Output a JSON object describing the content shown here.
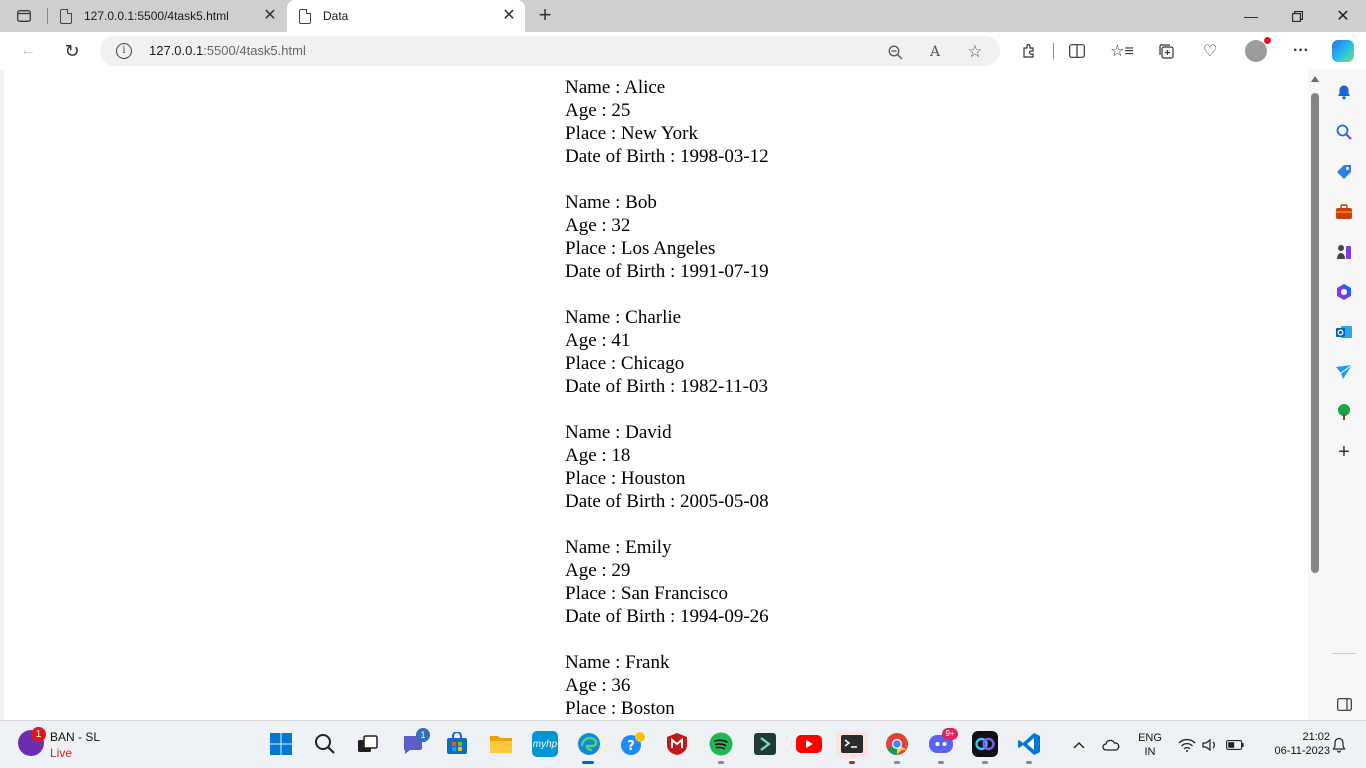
{
  "browser": {
    "tabs": [
      {
        "title": "127.0.0.1:5500/4task5.html",
        "active": false
      },
      {
        "title": "Data",
        "active": true
      }
    ],
    "address": {
      "host": "127.0.0.1",
      "rest": ":5500/4task5.html"
    }
  },
  "records": [
    {
      "name_label": "Name : Alice",
      "age_label": "Age : 25",
      "place_label": "Place : New York",
      "dob_label": "Date of Birth : 1998-03-12"
    },
    {
      "name_label": "Name : Bob",
      "age_label": "Age : 32",
      "place_label": "Place : Los Angeles",
      "dob_label": "Date of Birth : 1991-07-19"
    },
    {
      "name_label": "Name : Charlie",
      "age_label": "Age : 41",
      "place_label": "Place : Chicago",
      "dob_label": "Date of Birth : 1982-11-03"
    },
    {
      "name_label": "Name : David",
      "age_label": "Age : 18",
      "place_label": "Place : Houston",
      "dob_label": "Date of Birth : 2005-05-08"
    },
    {
      "name_label": "Name : Emily",
      "age_label": "Age : 29",
      "place_label": "Place : San Francisco",
      "dob_label": "Date of Birth : 1994-09-26"
    },
    {
      "name_label": "Name : Frank",
      "age_label": "Age : 36",
      "place_label": "Place : Boston",
      "dob_label": ""
    }
  ],
  "taskbar": {
    "weather": {
      "title": "BAN - SL",
      "status": "Live",
      "badge": "1"
    },
    "chat_badge": "1",
    "discord_badge": "9+",
    "language": {
      "line1": "ENG",
      "line2": "IN"
    },
    "clock": {
      "time": "21:02",
      "date": "06-11-2023"
    }
  },
  "colors": {
    "accent": "#0067c0",
    "live_red": "#c42b1c"
  }
}
